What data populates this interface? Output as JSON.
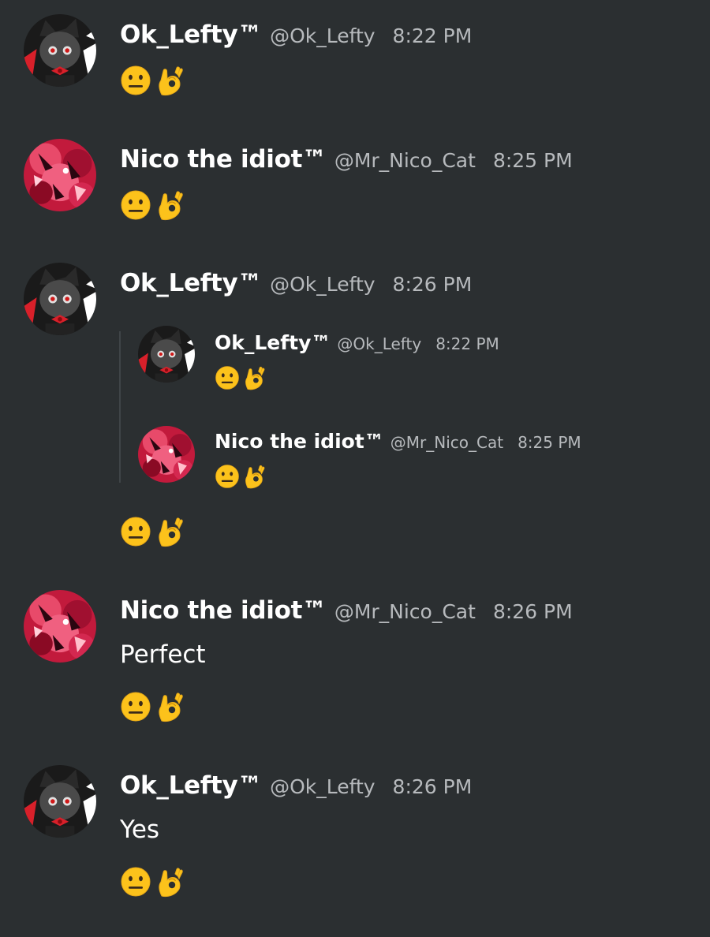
{
  "messages": [
    {
      "name": "Ok_Lefty™",
      "handle": "@Ok_Lefty",
      "time": "8:22 PM",
      "reactions": [
        "neutral-face",
        "ok-hand"
      ]
    },
    {
      "name": "Nico the idiot™",
      "handle": "@Mr_Nico_Cat",
      "time": "8:25 PM",
      "reactions": [
        "neutral-face",
        "ok-hand"
      ]
    },
    {
      "name": "Ok_Lefty™",
      "handle": "@Ok_Lefty",
      "time": "8:26 PM",
      "quoted": [
        {
          "name": "Ok_Lefty™",
          "handle": "@Ok_Lefty",
          "time": "8:22 PM",
          "reactions": [
            "neutral-face",
            "ok-hand"
          ]
        },
        {
          "name": "Nico the idiot™",
          "handle": "@Mr_Nico_Cat",
          "time": "8:25 PM",
          "reactions": [
            "neutral-face",
            "ok-hand"
          ]
        }
      ],
      "reactions": [
        "neutral-face",
        "ok-hand"
      ]
    },
    {
      "name": "Nico the idiot™",
      "handle": "@Mr_Nico_Cat",
      "time": "8:26 PM",
      "text": "Perfect",
      "reactions": [
        "neutral-face",
        "ok-hand"
      ]
    },
    {
      "name": "Ok_Lefty™",
      "handle": "@Ok_Lefty",
      "time": "8:26 PM",
      "text": "Yes",
      "reactions": [
        "neutral-face",
        "ok-hand"
      ]
    }
  ],
  "colors": {
    "background": "#2b2f31",
    "name": "#ffffff",
    "meta": "#b7babd",
    "quote_bar": "#3f4447"
  }
}
